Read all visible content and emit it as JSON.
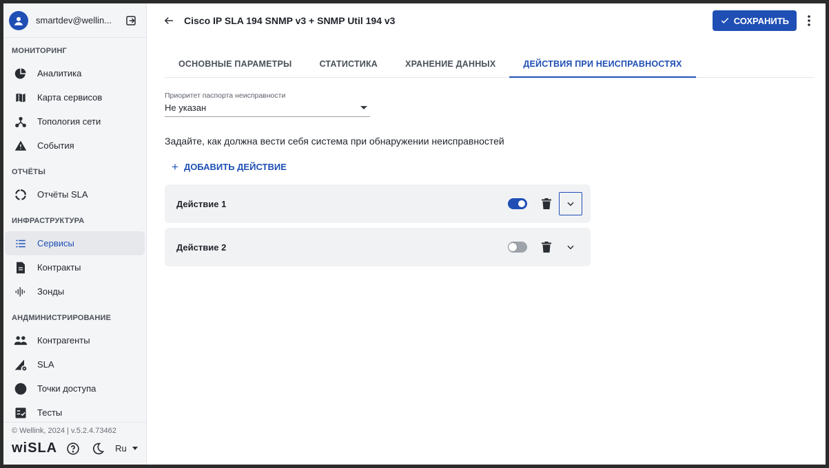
{
  "user": {
    "email": "smartdev@wellin..."
  },
  "sidebar": {
    "sections": [
      {
        "title": "МОНИТОРИНГ",
        "items": [
          {
            "label": "Аналитика",
            "icon": "pie-chart-icon"
          },
          {
            "label": "Карта сервисов",
            "icon": "map-icon"
          },
          {
            "label": "Топология сети",
            "icon": "topology-icon"
          },
          {
            "label": "События",
            "icon": "warning-icon"
          }
        ]
      },
      {
        "title": "ОТЧЁТЫ",
        "items": [
          {
            "label": "Отчёты SLA",
            "icon": "report-ring-icon"
          }
        ]
      },
      {
        "title": "ИНФРАСТРУКТУРА",
        "items": [
          {
            "label": "Сервисы",
            "icon": "list-icon",
            "active": true
          },
          {
            "label": "Контракты",
            "icon": "document-icon"
          },
          {
            "label": "Зонды",
            "icon": "probe-icon"
          }
        ]
      },
      {
        "title": "АНДМИНИСТРИРОВАНИЕ",
        "items": [
          {
            "label": "Контрагенты",
            "icon": "people-icon"
          },
          {
            "label": "SLA",
            "icon": "sla-settings-icon"
          },
          {
            "label": "Точки доступа",
            "icon": "circle-icon"
          },
          {
            "label": "Тесты",
            "icon": "checklist-icon"
          }
        ]
      }
    ],
    "footer": {
      "copyright": "© Wellink, 2024 | v.5.2.4.73462",
      "logo": "wiSLA",
      "language": "Ru"
    }
  },
  "header": {
    "title": "Cisco IP SLA 194 SNMP v3 + SNMP Util 194 v3",
    "save_label": "СОХРАНИТЬ"
  },
  "tabs": [
    {
      "label": "ОСНОВНЫЕ ПАРАМЕТРЫ",
      "active": false
    },
    {
      "label": "СТАТИСТИКА",
      "active": false
    },
    {
      "label": "ХРАНЕНИЕ ДАННЫХ",
      "active": false
    },
    {
      "label": "ДЕЙСТВИЯ ПРИ НЕИСПРАВНОСТЯХ",
      "active": true
    }
  ],
  "priority_field": {
    "label": "Приоритет паспорта неисправности",
    "value": "Не указан"
  },
  "hint": "Задайте, как должна вести себя система при обнаружении неисправностей",
  "add_action_label": "ДОБАВИТЬ ДЕЙСТВИЕ",
  "actions": [
    {
      "name": "Действие 1",
      "enabled": true
    },
    {
      "name": "Действие 2",
      "enabled": false
    }
  ],
  "colors": {
    "accent": "#1f4fb5",
    "sidebar_bg": "#f4f5f7",
    "card_bg": "#f1f2f4"
  }
}
